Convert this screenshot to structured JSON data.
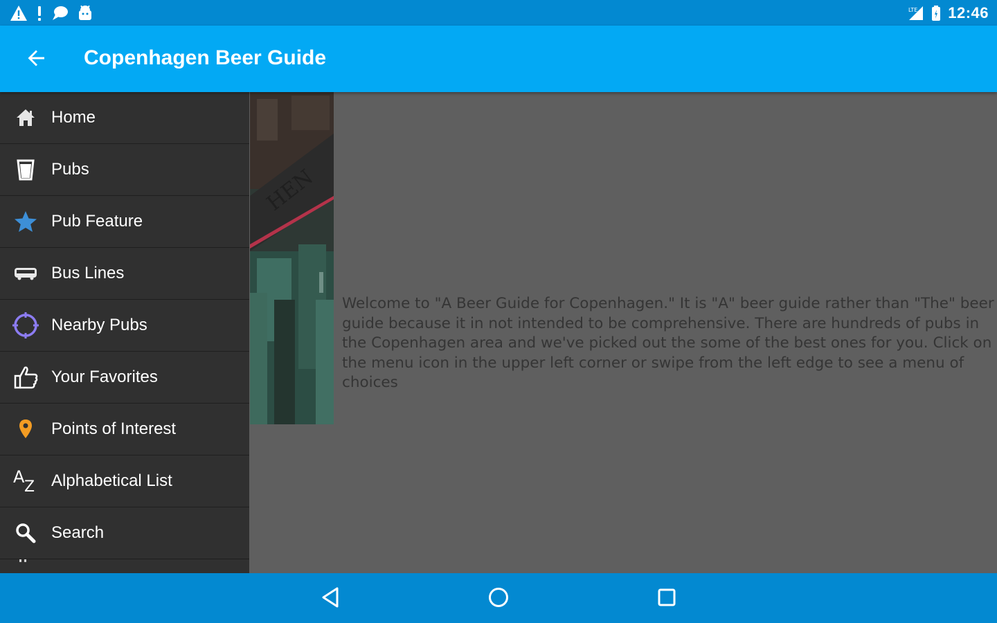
{
  "status_bar": {
    "time": "12:46",
    "left_icons": [
      "warning-icon",
      "alert-icon",
      "chat-icon",
      "android-icon"
    ],
    "right_icons": [
      "signal-icon",
      "battery-icon"
    ]
  },
  "app_bar": {
    "title": "Copenhagen Beer Guide",
    "back_icon": "arrow-back-icon",
    "color": "#03a9f4"
  },
  "drawer": {
    "items": [
      {
        "label": "Home",
        "icon": "home-icon"
      },
      {
        "label": "Pubs",
        "icon": "pint-glass-icon"
      },
      {
        "label": "Pub Feature",
        "icon": "star-icon"
      },
      {
        "label": "Bus Lines",
        "icon": "bus-icon"
      },
      {
        "label": "Nearby Pubs",
        "icon": "location-target-icon"
      },
      {
        "label": "Your Favorites",
        "icon": "thumbs-up-icon"
      },
      {
        "label": "Points of Interest",
        "icon": "map-pin-icon"
      },
      {
        "label": "Alphabetical List",
        "icon": "a-z-icon"
      },
      {
        "label": "Search",
        "icon": "search-icon"
      }
    ]
  },
  "main": {
    "welcome_text": "Welcome to \"A Beer Guide for Copenhagen.\" It is \"A\" beer guide rather than \"The\" beer guide because it in not intended to be comprehensive. There are hundreds of pubs in the Copenhagen area and we've picked out the some of the best ones for you. Click on the menu icon in the upper left corner or swipe from the left edge to see a menu of choices"
  },
  "nav_bar": {
    "buttons": [
      "back-nav-icon",
      "home-nav-icon",
      "recents-nav-icon"
    ],
    "color": "#0389d1"
  }
}
